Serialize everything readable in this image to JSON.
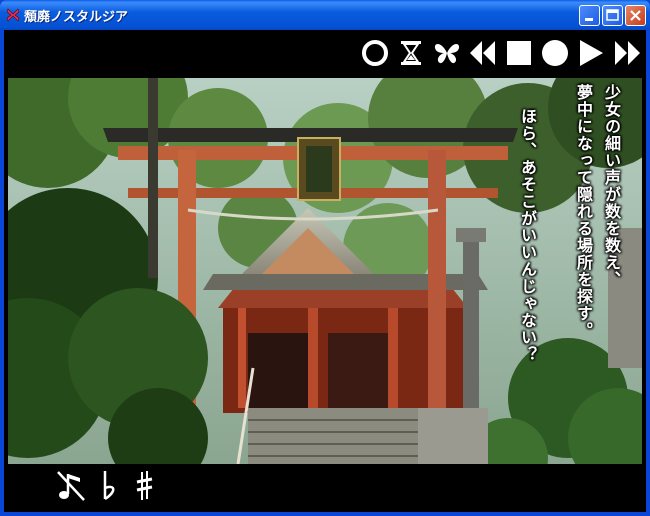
{
  "window": {
    "title": "頽廃ノスタルジア"
  },
  "toolbar": {
    "icons": [
      "circle-icon",
      "hourglass-icon",
      "butterfly-icon",
      "rewind-icon",
      "stop-icon",
      "record-icon",
      "play-icon",
      "fast-forward-icon"
    ]
  },
  "dialog": {
    "lines": [
      "少女の細い声が数を数え、",
      "夢中になって隠れる場所を探す。",
      "ほら、あそこがいいんじゃない？"
    ]
  },
  "music": {
    "icons": [
      "mute-music-icon",
      "flat-icon",
      "sharp-icon"
    ]
  },
  "colors": {
    "titlebar": "#0a5ddf",
    "background": "#000000",
    "text": "#ffffff"
  }
}
